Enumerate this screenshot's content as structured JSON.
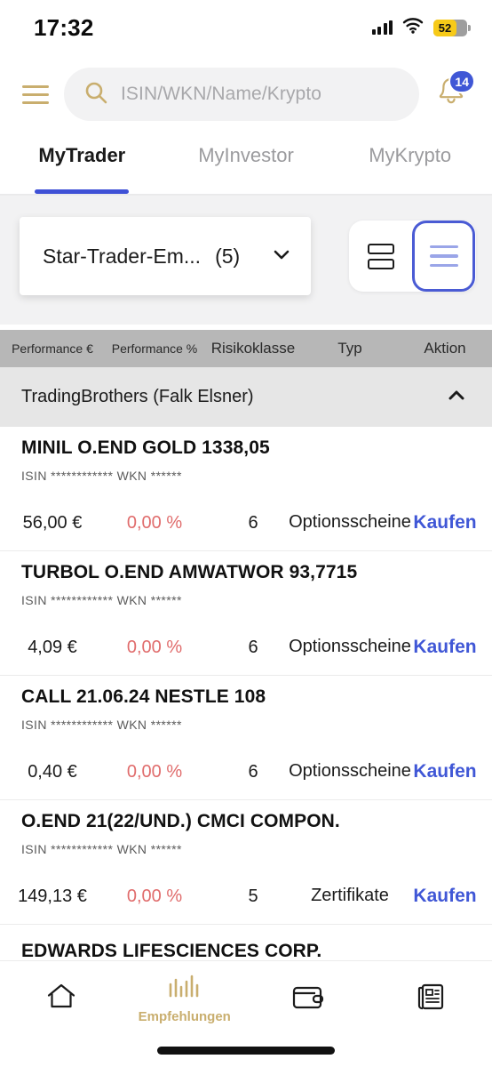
{
  "statusbar": {
    "time": "17:32",
    "signal_icon": "cellular-signal-icon",
    "wifi_icon": "wifi-icon",
    "battery_icon": "battery-icon",
    "battery_level": "52",
    "battery_color": "#f7ca18"
  },
  "topbar": {
    "menu_icon": "hamburger-menu-icon",
    "menu_color": "#c9ae6e",
    "search": {
      "icon": "search-icon",
      "placeholder": "ISIN/WKN/Name/Krypto",
      "value": ""
    },
    "notifications": {
      "icon": "bell-icon",
      "badge_count": "14",
      "badge_color": "#4057d6"
    }
  },
  "tabs": {
    "active_index": 0,
    "accent_color": "#3f51d6",
    "items": [
      {
        "label": "MyTrader"
      },
      {
        "label": "MyInvestor"
      },
      {
        "label": "MyKrypto"
      }
    ]
  },
  "selector": {
    "portfolio_name": "Star-Trader-Em...",
    "portfolio_count": "(5)",
    "chevron_icon": "chevron-down-icon",
    "view_toggle": {
      "card_view_icon": "card-view-icon",
      "list_view_icon": "list-view-icon",
      "active": "list",
      "active_color": "#4a5bd4"
    }
  },
  "table": {
    "columns": [
      {
        "label": "Performance €"
      },
      {
        "label": "Performance %"
      },
      {
        "label": "Risikoklasse"
      },
      {
        "label": "Typ"
      },
      {
        "label": "Aktion"
      }
    ],
    "group": {
      "label": "TradingBrothers (Falk Elsner)",
      "chevron_icon": "chevron-up-icon",
      "expanded": true
    },
    "rows": [
      {
        "title": "MINIL O.END GOLD 1338,05",
        "identifiers": "ISIN ************ WKN ******",
        "performance_eur": "56,00 €",
        "performance_pct": "0,00 %",
        "risk_class": "6",
        "type": "Optionsscheine",
        "action": "Kaufen"
      },
      {
        "title": "TURBOL O.END AMWATWOR 93,7715",
        "identifiers": "ISIN ************ WKN ******",
        "performance_eur": "4,09 €",
        "performance_pct": "0,00 %",
        "risk_class": "6",
        "type": "Optionsscheine",
        "action": "Kaufen"
      },
      {
        "title": "CALL 21.06.24 NESTLE 108",
        "identifiers": "ISIN ************ WKN ******",
        "performance_eur": "0,40 €",
        "performance_pct": "0,00 %",
        "risk_class": "6",
        "type": "Optionsscheine",
        "action": "Kaufen"
      },
      {
        "title": "O.END 21(22/UND.) CMCI COMPON.",
        "identifiers": "ISIN ************ WKN ******",
        "performance_eur": "149,13 €",
        "performance_pct": "0,00 %",
        "risk_class": "5",
        "type": "Zertifikate",
        "action": "Kaufen"
      }
    ],
    "partial_row": {
      "title": "EDWARDS LIFESCIENCES CORP."
    },
    "negative_color": "#e06c6c",
    "action_color": "#4057d6"
  },
  "bottomnav": {
    "accent_color": "#c9ae6e",
    "items": [
      {
        "icon": "home-icon",
        "label": ""
      },
      {
        "icon": "bar-chart-icon",
        "label": "Empfehlungen"
      },
      {
        "icon": "wallet-icon",
        "label": ""
      },
      {
        "icon": "news-icon",
        "label": ""
      }
    ],
    "active_index": 1,
    "home_indicator": "home-indicator"
  }
}
